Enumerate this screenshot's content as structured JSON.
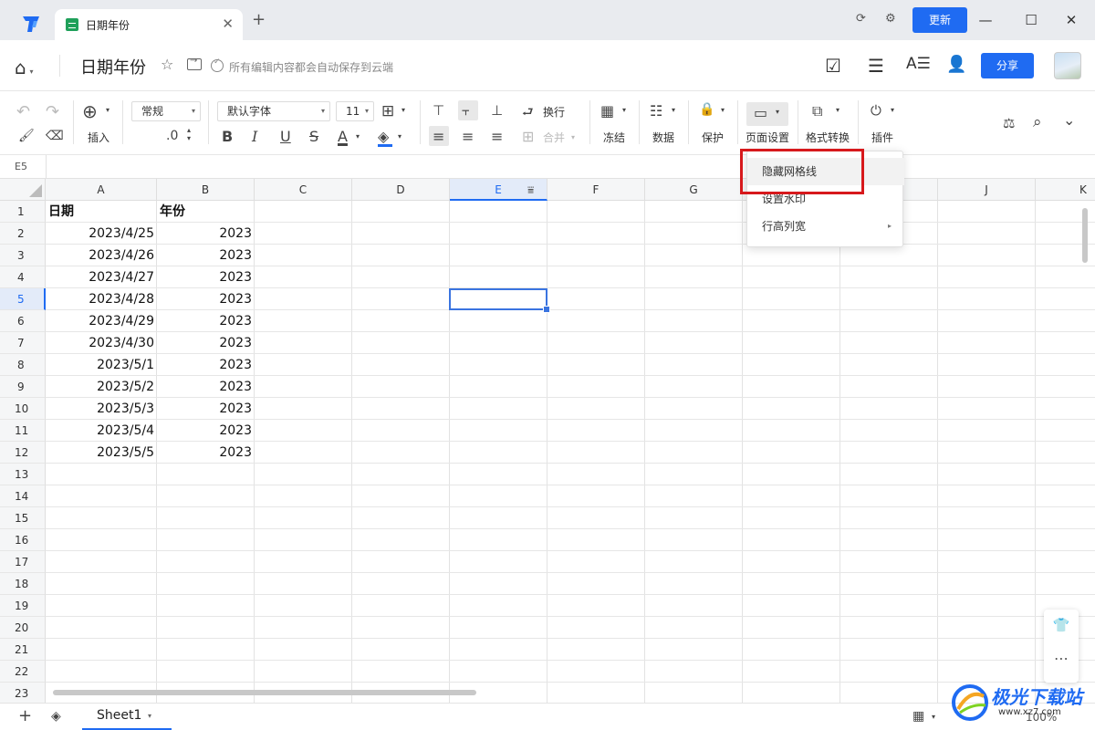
{
  "colors": {
    "accent": "#1f6bf2",
    "highlight": "#d7191c",
    "sheet_icon": "#1fa05a"
  },
  "window": {
    "tab_title": "日期年份",
    "close_glyph": "✕",
    "add_glyph": "+",
    "update_label": "更新",
    "minimize_glyph": "—",
    "maximize_glyph": "☐",
    "close_window_glyph": "✕",
    "sync_glyph": "⟳",
    "settings_glyph": "⚙"
  },
  "doc": {
    "title": "日期年份",
    "star_glyph": "☆",
    "saved_text": "所有编辑内容都会自动保存到云端",
    "share_label": "分享",
    "home_glyph": "⌂",
    "caret": "▾",
    "check_add_glyph": "☑",
    "menu_glyph": "☰",
    "font_glyph": "A☰",
    "user_glyph": "👤"
  },
  "toolbar": {
    "undo": "↶",
    "redo": "↷",
    "format_painter": "🖌",
    "eraser": "⌫",
    "insert_glyph": "⊕",
    "insert_label": "插入",
    "number_format": "常规",
    "decimal": ".0",
    "font_name": "默认字体",
    "font_size": "11",
    "bold": "B",
    "italic": "I",
    "underline": "U",
    "strike": "S",
    "font_color": "A",
    "fill": "◈",
    "border_glyph": "⊞",
    "align_top": "⊤",
    "align_middle": "⫟",
    "align_bottom": "⊥",
    "align_left": "≡",
    "align_center": "≡",
    "align_right": "≡",
    "wrap_glyph": "⮐",
    "wrap_label": "换行",
    "merge_glyph": "⊞",
    "merge_label": "合并",
    "freeze_glyph": "▦",
    "freeze_label": "冻结",
    "data_glyph": "☷",
    "data_label": "数据",
    "protect_glyph": "🔒",
    "protect_label": "保护",
    "page_setup_glyph": "▭",
    "page_setup_label": "页面设置",
    "format_convert_glyph": "⧉",
    "format_convert_label": "格式转换",
    "plugin_glyph": "⏻",
    "plugin_label": "插件",
    "tools_glyph": "⚖",
    "search_glyph": "⌕",
    "collapse_glyph": "⌄",
    "caret": "▾"
  },
  "namebox": {
    "cell_ref": "E5"
  },
  "grid": {
    "columns": [
      "A",
      "B",
      "C",
      "D",
      "E",
      "F",
      "G",
      "H",
      "I",
      "J",
      "K"
    ],
    "selected_column": "E",
    "selected_row": 5,
    "rows": [
      "1",
      "2",
      "3",
      "4",
      "5",
      "6",
      "7",
      "8",
      "9",
      "10",
      "11",
      "12",
      "13",
      "14",
      "15",
      "16",
      "17",
      "18",
      "19",
      "20",
      "21",
      "22",
      "23"
    ],
    "header_a": "日期",
    "header_b": "年份",
    "dates": [
      "2023/4/25",
      "2023/4/26",
      "2023/4/27",
      "2023/4/28",
      "2023/4/29",
      "2023/4/30",
      "2023/5/1",
      "2023/5/2",
      "2023/5/3",
      "2023/5/4",
      "2023/5/5"
    ],
    "years": [
      "2023",
      "2023",
      "2023",
      "2023",
      "2023",
      "2023",
      "2023",
      "2023",
      "2023",
      "2023",
      "2023"
    ],
    "filter_glyph": "⩸"
  },
  "menu": {
    "items": [
      {
        "label": "隐藏网格线"
      },
      {
        "label": "设置水印"
      },
      {
        "label": "行高列宽",
        "submenu_glyph": "▸"
      }
    ]
  },
  "side_tools": {
    "shirt_glyph": "👕",
    "more_glyph": "⋯"
  },
  "bottom": {
    "add_glyph": "+",
    "layers_glyph": "◈",
    "sheet_name": "Sheet1",
    "caret": "▾",
    "view_glyph": "▦",
    "zoom": "100%"
  },
  "watermark": {
    "text": "极光下载站",
    "url": "www.xz7.com"
  }
}
